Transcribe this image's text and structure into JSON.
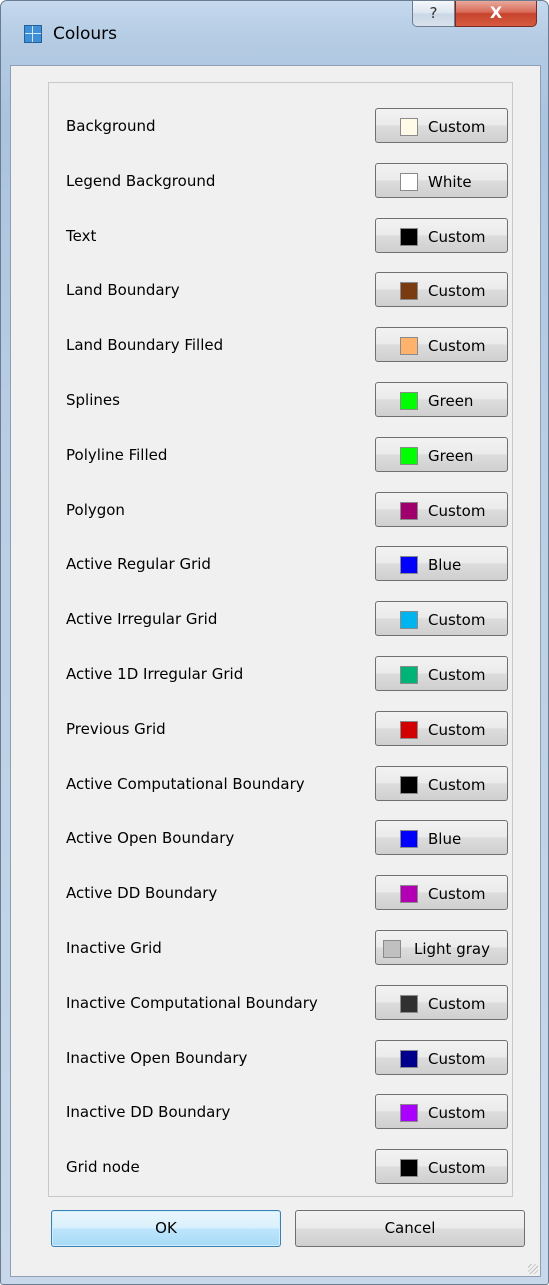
{
  "window": {
    "title": "Colours",
    "help_glyph": "?",
    "close_glyph": "X",
    "app_icon": "grid-window-icon"
  },
  "rows": [
    {
      "label": "Background",
      "button": "Custom",
      "swatch": "#fffbe8"
    },
    {
      "label": "Legend Background",
      "button": "White",
      "swatch": "#ffffff"
    },
    {
      "label": "Text",
      "button": "Custom",
      "swatch": "#000000"
    },
    {
      "label": "Land Boundary",
      "button": "Custom",
      "swatch": "#7a3b10"
    },
    {
      "label": "Land Boundary Filled",
      "button": "Custom",
      "swatch": "#ffb26b"
    },
    {
      "label": "Splines",
      "button": "Green",
      "swatch": "#00ff00"
    },
    {
      "label": "Polyline Filled",
      "button": "Green",
      "swatch": "#00ff00"
    },
    {
      "label": "Polygon",
      "button": "Custom",
      "swatch": "#a0006e"
    },
    {
      "label": "Active Regular Grid",
      "button": "Blue",
      "swatch": "#0000ff"
    },
    {
      "label": "Active Irregular Grid",
      "button": "Custom",
      "swatch": "#00b4f0"
    },
    {
      "label": "Active 1D Irregular Grid",
      "button": "Custom",
      "swatch": "#00b478"
    },
    {
      "label": "Previous Grid",
      "button": "Custom",
      "swatch": "#d20000"
    },
    {
      "label": "Active Computational Boundary",
      "button": "Custom",
      "swatch": "#000000"
    },
    {
      "label": "Active Open Boundary",
      "button": "Blue",
      "swatch": "#0000ff"
    },
    {
      "label": "Active DD Boundary",
      "button": "Custom",
      "swatch": "#b400b4"
    },
    {
      "label": "Inactive Grid",
      "button": "Light gray",
      "swatch": "#c0c0c0"
    },
    {
      "label": "Inactive Computational Boundary",
      "button": "Custom",
      "swatch": "#303030"
    },
    {
      "label": "Inactive Open Boundary",
      "button": "Custom",
      "swatch": "#00008c"
    },
    {
      "label": "Inactive DD Boundary",
      "button": "Custom",
      "swatch": "#aa00ff"
    },
    {
      "label": "Grid node",
      "button": "Custom",
      "swatch": "#000000"
    }
  ],
  "footer": {
    "ok_label": "OK",
    "cancel_label": "Cancel"
  }
}
